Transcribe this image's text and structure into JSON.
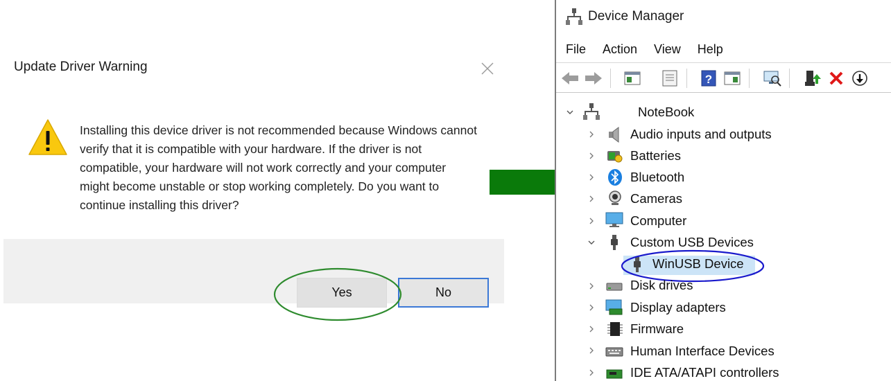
{
  "dialog": {
    "title": "Update Driver Warning",
    "message": "Installing this device driver is not recommended because Windows cannot verify that it is compatible with your hardware.  If the driver is not compatible, your hardware will not work correctly and your computer might become unstable or stop working completely.  Do you want to continue installing this driver?",
    "yes_label": "Yes",
    "no_label": "No",
    "highlight_color": "#2e8b2e"
  },
  "arrow_color": "#0a7a0a",
  "device_manager": {
    "title": "Device Manager",
    "menu": [
      "File",
      "Action",
      "View",
      "Help"
    ],
    "toolbar_icons": [
      "back-arrow-icon",
      "forward-arrow-icon",
      "show-hide-console-tree-icon",
      "properties-icon",
      "help-icon",
      "action-pane-icon",
      "scan-hardware-icon",
      "update-driver-icon",
      "uninstall-device-icon",
      "disable-device-icon"
    ],
    "root": "NoteBook",
    "categories": [
      {
        "label": "Audio inputs and outputs",
        "icon": "speaker-icon"
      },
      {
        "label": "Batteries",
        "icon": "battery-icon"
      },
      {
        "label": "Bluetooth",
        "icon": "bluetooth-icon"
      },
      {
        "label": "Cameras",
        "icon": "camera-icon"
      },
      {
        "label": "Computer",
        "icon": "monitor-icon"
      },
      {
        "label": "Custom USB Devices",
        "icon": "usb-plug-icon",
        "expanded": true
      },
      {
        "label": "Disk drives",
        "icon": "disk-drive-icon"
      },
      {
        "label": "Display adapters",
        "icon": "display-adapter-icon"
      },
      {
        "label": "Firmware",
        "icon": "firmware-chip-icon"
      },
      {
        "label": "Human Interface Devices",
        "icon": "hid-keyboard-icon"
      },
      {
        "label": "IDE ATA/ATAPI controllers",
        "icon": "ide-controller-icon"
      }
    ],
    "child_device": {
      "label": "WinUSB Device",
      "icon": "usb-plug-icon"
    },
    "selection_ring_color": "#1a1acc"
  }
}
